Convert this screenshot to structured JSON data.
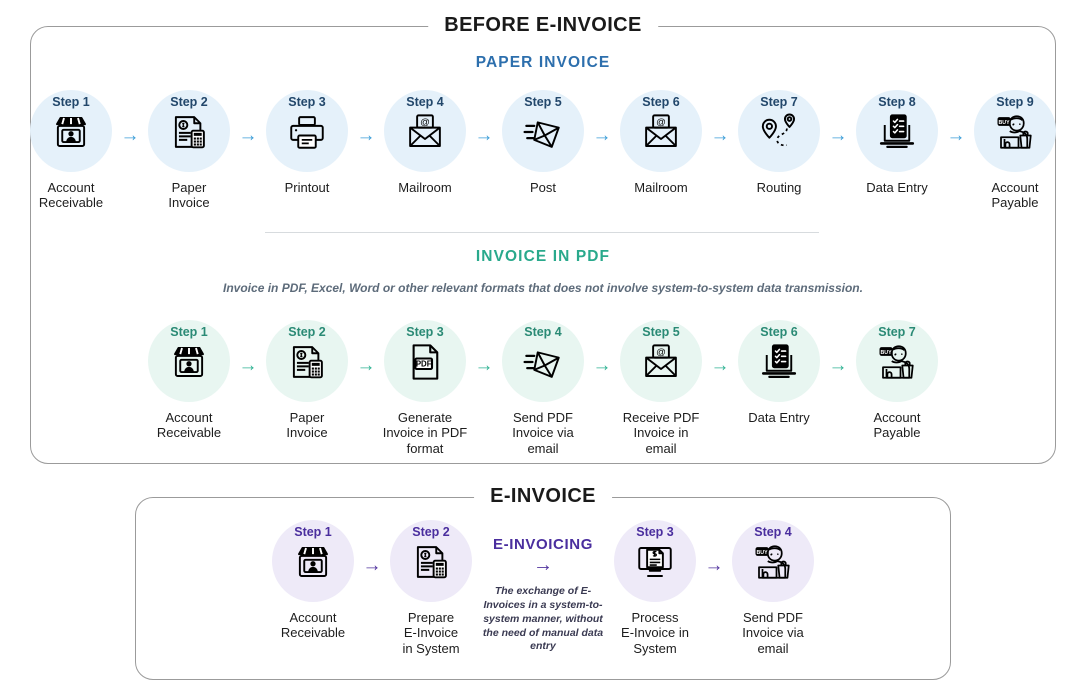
{
  "panels": {
    "before": {
      "title": "BEFORE E-INVOICE"
    },
    "einvoice": {
      "title": "E-INVOICE"
    }
  },
  "sections": {
    "paper": {
      "heading": "PAPER INVOICE",
      "heading_color": "#2d6fad",
      "accent_color": "#3d9ed8",
      "bubble_color": "#e5f1fa",
      "steps": [
        {
          "label": "Step 1",
          "caption": "Account\nReceivable",
          "icon": "storefront-icon"
        },
        {
          "label": "Step 2",
          "caption": "Paper\nInvoice",
          "icon": "invoice-calculator-icon"
        },
        {
          "label": "Step 3",
          "caption": "Printout",
          "icon": "printer-icon"
        },
        {
          "label": "Step 4",
          "caption": "Mailroom",
          "icon": "email-envelope-icon"
        },
        {
          "label": "Step 5",
          "caption": "Post",
          "icon": "sending-envelope-icon"
        },
        {
          "label": "Step 6",
          "caption": "Mailroom",
          "icon": "email-envelope-icon"
        },
        {
          "label": "Step 7",
          "caption": "Routing",
          "icon": "routing-pins-icon"
        },
        {
          "label": "Step 8",
          "caption": "Data Entry",
          "icon": "laptop-checklist-icon"
        },
        {
          "label": "Step 9",
          "caption": "Account\nPayable",
          "icon": "shopper-buy-icon"
        }
      ]
    },
    "pdf": {
      "heading": "INVOICE IN PDF",
      "heading_color": "#29a98c",
      "note": "Invoice in PDF, Excel, Word or other relevant formats that does not involve system-to-system data transmission.",
      "accent_color": "#31b394",
      "bubble_color": "#e8f6f1",
      "steps": [
        {
          "label": "Step 1",
          "caption": "Account\nReceivable",
          "icon": "storefront-icon"
        },
        {
          "label": "Step 2",
          "caption": "Paper\nInvoice",
          "icon": "invoice-calculator-icon"
        },
        {
          "label": "Step 3",
          "caption": "Generate\nInvoice in PDF\nformat",
          "icon": "pdf-file-icon"
        },
        {
          "label": "Step 4",
          "caption": "Send PDF\nInvoice via\nemail",
          "icon": "sending-envelope-icon"
        },
        {
          "label": "Step 5",
          "caption": "Receive PDF\nInvoice in\nemail",
          "icon": "email-envelope-icon"
        },
        {
          "label": "Step 6",
          "caption": "Data Entry",
          "icon": "laptop-checklist-icon"
        },
        {
          "label": "Step 7",
          "caption": "Account\nPayable",
          "icon": "shopper-buy-icon"
        }
      ]
    },
    "einvoice": {
      "accent_color": "#52349f",
      "bubble_color": "#eeeaf8",
      "middle": {
        "title": "E-INVOICING",
        "arrow": "→",
        "description": "The exchange of E-Invoices in a system-to-system manner, without the need of manual data entry"
      },
      "steps_left": [
        {
          "label": "Step 1",
          "caption": "Account\nReceivable",
          "icon": "storefront-icon"
        },
        {
          "label": "Step 2",
          "caption": "Prepare\nE-Invoice\nin System",
          "icon": "invoice-calculator-icon"
        }
      ],
      "steps_right": [
        {
          "label": "Step 3",
          "caption": "Process\nE-Invoice in\nSystem",
          "icon": "monitor-invoice-icon"
        },
        {
          "label": "Step 4",
          "caption": "Send PDF\nInvoice via\nemail",
          "icon": "shopper-buy-icon"
        }
      ]
    }
  },
  "arrow_glyph": "→"
}
